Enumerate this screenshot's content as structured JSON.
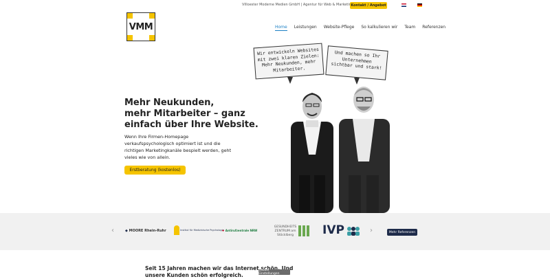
{
  "header": {
    "tagline": "VIlloester Moderne Medien GmbH | Agentur für Web & Marketing",
    "contact_label": "Kontakt / Angebot",
    "logo_text": "VMM",
    "languages": [
      "en-flag-icon",
      "de-flag-icon"
    ]
  },
  "nav": {
    "items": [
      "Home",
      "Leistungen",
      "Website-Pflege",
      "So kalkulieren wir",
      "Team",
      "Referenzen"
    ],
    "active_index": 0
  },
  "hero": {
    "title_lines": [
      "Mehr Neukunden,",
      "mehr Mitarbeiter – ganz",
      "einfach über Ihre Website."
    ],
    "text_lines": [
      "Wenn Ihre Firmen-Homepage",
      "verkaufspsychologisch optimiert ist und die",
      "richtigen Marketingkanäle bespielt werden, geht",
      "vieles wie von allein."
    ],
    "cta_label": "Erstberatung (kostenlos)",
    "bubble_left": [
      "Wir entwickeln Websites",
      "mit zwei klaren Zielen:",
      "Mehr Neukunden, mehr",
      "Mitarbeiter."
    ],
    "bubble_right": [
      "Und machen so Ihr",
      "Unternehmen",
      "sichtbar und stark!"
    ]
  },
  "partners": {
    "logos": [
      "MOORE Rhein-Ruhr",
      "Institut für Medizinische Psychologie",
      "Antirufzentrale NRW",
      "GESUNDHEITS ZENTRUM am Stöcklberg",
      "IVP"
    ],
    "more_label": "Mehr Referenzen"
  },
  "intro": {
    "lines": [
      "Seit 15 Jahren machen wir das Internet schön. Und",
      "unsere Kunden schön erfolgreich."
    ]
  },
  "cookie": {
    "label": "Cookie Einstellungen"
  },
  "colors": {
    "accent": "#f5c400",
    "nav_active": "#1a7fc4",
    "dark_button": "#1e2b4a"
  }
}
